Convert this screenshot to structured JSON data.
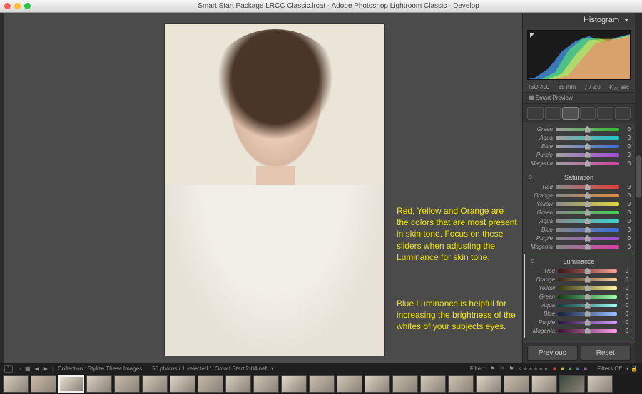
{
  "window": {
    "title": "Smart Start Package LRCC Classic.lrcat - Adobe Photoshop Lightroom Classic - Develop"
  },
  "annotations": {
    "a1": "Red, Yellow and Orange are the colors that are most present in skin tone. Focus on these sliders when adjusting the Luminance for skin tone.",
    "a2": "Blue Luminance is helpful for increasing the brightness of the whites of your subjects eyes."
  },
  "histogram": {
    "title": "Histogram",
    "iso": "ISO 400",
    "focal": "85 mm",
    "aperture": "ƒ / 2.0",
    "shutter": "¹⁄₁₆₀ sec",
    "smart_preview": "Smart Preview"
  },
  "partial_group": {
    "rows": [
      {
        "label": "Green",
        "value": 0,
        "grad": "linear-gradient(90deg,#a0a0a0,#2dbb2d)"
      },
      {
        "label": "Aqua",
        "value": 0,
        "grad": "linear-gradient(90deg,#a0a0a0,#1cc7c7)"
      },
      {
        "label": "Blue",
        "value": 0,
        "grad": "linear-gradient(90deg,#a0a0a0,#3b6bdc)"
      },
      {
        "label": "Purple",
        "value": 0,
        "grad": "linear-gradient(90deg,#a0a0a0,#a04bd6)"
      },
      {
        "label": "Magenta",
        "value": 0,
        "grad": "linear-gradient(90deg,#a0a0a0,#d63fa8)"
      }
    ]
  },
  "saturation": {
    "title": "Saturation",
    "rows": [
      {
        "label": "Red",
        "value": 0,
        "grad": "linear-gradient(90deg,#888,#e23b3b)"
      },
      {
        "label": "Orange",
        "value": 0,
        "grad": "linear-gradient(90deg,#888,#e28a3b)"
      },
      {
        "label": "Yellow",
        "value": 0,
        "grad": "linear-gradient(90deg,#888,#e2d63b)"
      },
      {
        "label": "Green",
        "value": 0,
        "grad": "linear-gradient(90deg,#888,#3bd64e)"
      },
      {
        "label": "Aqua",
        "value": 0,
        "grad": "linear-gradient(90deg,#888,#3bd6cf)"
      },
      {
        "label": "Blue",
        "value": 0,
        "grad": "linear-gradient(90deg,#888,#3b6bdc)"
      },
      {
        "label": "Purple",
        "value": 0,
        "grad": "linear-gradient(90deg,#888,#a04bd6)"
      },
      {
        "label": "Magenta",
        "value": 0,
        "grad": "linear-gradient(90deg,#888,#d63fa8)"
      }
    ]
  },
  "luminance": {
    "title": "Luminance",
    "rows": [
      {
        "label": "Red",
        "value": 0,
        "grad": "linear-gradient(90deg,#3a1212,#ff9c9c)"
      },
      {
        "label": "Orange",
        "value": 0,
        "grad": "linear-gradient(90deg,#3a2612,#ffcf9c)"
      },
      {
        "label": "Yellow",
        "value": 0,
        "grad": "linear-gradient(90deg,#3a3812,#fff69c)"
      },
      {
        "label": "Green",
        "value": 0,
        "grad": "linear-gradient(90deg,#123a16,#9cffab)"
      },
      {
        "label": "Aqua",
        "value": 0,
        "grad": "linear-gradient(90deg,#123a39,#9cfff7)"
      },
      {
        "label": "Blue",
        "value": 0,
        "grad": "linear-gradient(90deg,#12203a,#9cc2ff)"
      },
      {
        "label": "Purple",
        "value": 0,
        "grad": "linear-gradient(90deg,#2a123a,#d49cff)"
      },
      {
        "label": "Magenta",
        "value": 0,
        "grad": "linear-gradient(90deg,#3a1231,#ff9ce7)"
      }
    ]
  },
  "buttons": {
    "previous": "Previous",
    "reset": "Reset"
  },
  "toolbar": {
    "view_badge": "1",
    "collection_label": "Collection : Stylize These Images",
    "count": "50 photos / 1 selected /",
    "filename": "Smart Start 2-04.nef",
    "filter_label": "Filter :",
    "filters_off": "Filters Off"
  },
  "thumbs": [
    "#d8cdbf",
    "#cbb9a5",
    "#e7dfd0",
    "#d9cec0",
    "#c7bba9",
    "#d2c7b6",
    "#ded4c5",
    "#c3b8a7",
    "#d6ccbd",
    "#cfc4b3",
    "#e3d9ca",
    "#cabfae",
    "#d0c5b4",
    "#dcd2c3",
    "#c6bbaa",
    "#d4c9b8",
    "#cec3b2",
    "#e1d7c8",
    "#c9beac",
    "#d7ccbd",
    "#3a4a3a",
    "#d5cabb"
  ],
  "selected_thumb_index": 2
}
